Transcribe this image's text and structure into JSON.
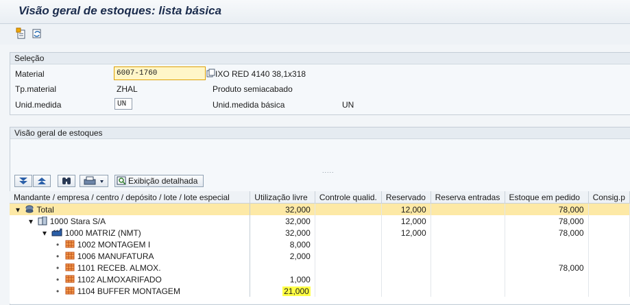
{
  "title": "Visão geral de estoques: lista básica",
  "toolbar": {
    "icons": [
      "new-doc-icon",
      "refresh-icon"
    ]
  },
  "selection": {
    "header": "Seleção",
    "material_label": "Material",
    "material_value": "6007-1760",
    "material_desc": "IXO RED 4140 38,1x318",
    "tp_label": "Tp.material",
    "tp_value": "ZHAL",
    "tp_desc": "Produto semiacabado",
    "unid_label": "Unid.medida",
    "unid_value": "UN",
    "unid_base_label": "Unid.medida básica",
    "unid_base_value": "UN"
  },
  "overview": {
    "header": "Visão geral de estoques",
    "detail_button": "Exibição detalhada",
    "dots": "....."
  },
  "table": {
    "columns": [
      "Mandante / empresa / centro / depósito / lote / lote especial",
      "Utilização livre",
      "Controle qualid.",
      "Reservado",
      "Reserva entradas",
      "Estoque em pedido",
      "Consig.p"
    ],
    "rows": [
      {
        "label": "Total",
        "livre": "32,000",
        "qualid": "",
        "reservado": "12,000",
        "entradas": "",
        "pedido": "78,000"
      },
      {
        "label": "1000 Stara S/A",
        "livre": "32,000",
        "qualid": "",
        "reservado": "12,000",
        "entradas": "",
        "pedido": "78,000"
      },
      {
        "label": "1000 MATRIZ (NMT)",
        "livre": "32,000",
        "qualid": "",
        "reservado": "12,000",
        "entradas": "",
        "pedido": "78,000"
      },
      {
        "label": "1002 MONTAGEM I",
        "livre": "8,000",
        "qualid": "",
        "reservado": "",
        "entradas": "",
        "pedido": ""
      },
      {
        "label": "1006 MANUFATURA",
        "livre": "2,000",
        "qualid": "",
        "reservado": "",
        "entradas": "",
        "pedido": ""
      },
      {
        "label": "1101 RECEB. ALMOX.",
        "livre": "",
        "qualid": "",
        "reservado": "",
        "entradas": "",
        "pedido": "78,000"
      },
      {
        "label": "1102 ALMOXARIFADO",
        "livre": "1,000",
        "qualid": "",
        "reservado": "",
        "entradas": "",
        "pedido": ""
      },
      {
        "label": "1104 BUFFER MONTAGEM",
        "livre": "21,000",
        "qualid": "",
        "reservado": "",
        "entradas": "",
        "pedido": ""
      }
    ]
  }
}
